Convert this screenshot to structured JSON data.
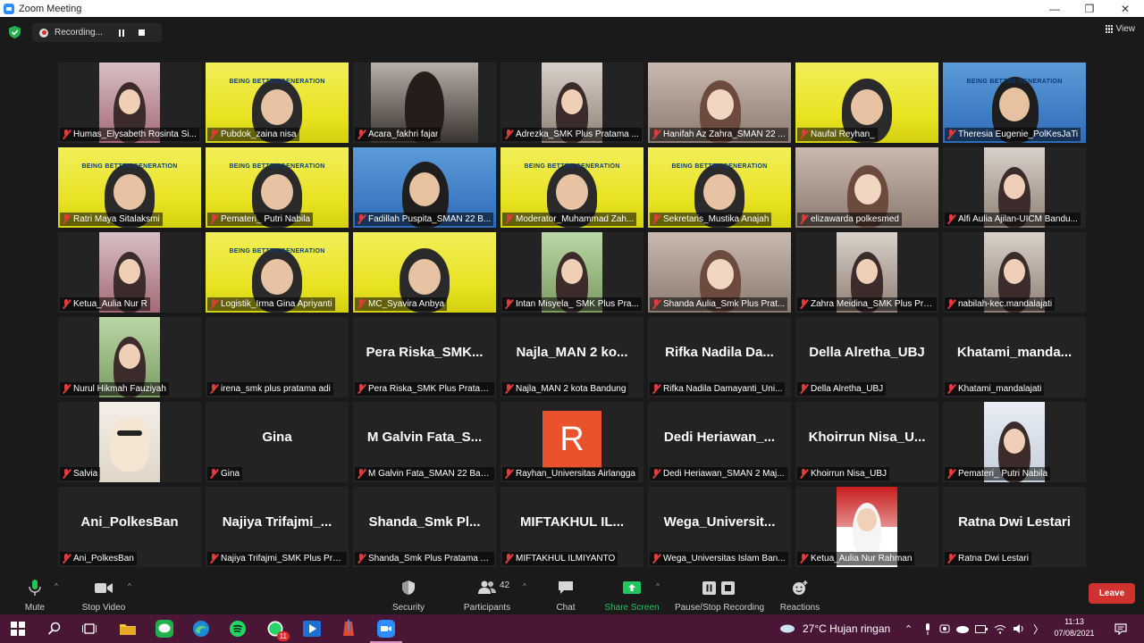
{
  "window": {
    "title": "Zoom Meeting"
  },
  "recording": {
    "label": "Recording..."
  },
  "view_label": "View",
  "participants_tiles": [
    {
      "name": "Humas_Elysabeth Rosinta Si...",
      "big": "",
      "kind": "narrow-pink"
    },
    {
      "name": "Pubdok_zaina nisa",
      "big": "",
      "kind": "yellow",
      "active": true,
      "banner": "BEING BETTER GENERATION"
    },
    {
      "name": "Acara_fakhri fajar",
      "big": "",
      "kind": "dark-narrow"
    },
    {
      "name": "Adrezka_SMK Plus Pratama ...",
      "big": "",
      "kind": "narrow-room"
    },
    {
      "name": "Hanifah Az Zahra_SMAN 22 ...",
      "big": "",
      "kind": "room"
    },
    {
      "name": "Naufal Reyhan_",
      "big": "",
      "kind": "yellow-plain"
    },
    {
      "name": "Theresia Eugenie_PolKesJaTi",
      "big": "",
      "kind": "blue",
      "banner": "BEING BETTER GENERATION"
    },
    {
      "name": "Ratri Maya Sitalaksmi",
      "big": "",
      "kind": "yellow",
      "banner": "BEING BETTER GENERATION"
    },
    {
      "name": "Pemateri_ Putri Nabila",
      "big": "",
      "kind": "yellow",
      "banner": "BEING BETTER GENERATION"
    },
    {
      "name": "Fadillah Puspita_SMAN 22 B...",
      "big": "",
      "kind": "blue"
    },
    {
      "name": "Moderator_Muhammad Zah...",
      "big": "",
      "kind": "yellow",
      "banner": "BEING BETTER GENERATION"
    },
    {
      "name": "Sekretaris_Mustika Anajah",
      "big": "",
      "kind": "yellow",
      "banner": "BEING BETTER GENERATION"
    },
    {
      "name": "elizawarda polkesmed",
      "big": "",
      "kind": "room"
    },
    {
      "name": "Alfi Aulia Ajilan-UICM Bandu...",
      "big": "",
      "kind": "narrow-room"
    },
    {
      "name": "Ketua_Aulia Nur R",
      "big": "",
      "kind": "narrow-pink"
    },
    {
      "name": "Logistik_Irma Gina Apriyanti",
      "big": "",
      "kind": "yellow",
      "banner": "BEING BETTER GENERATION"
    },
    {
      "name": "MC_Syavira Anbya",
      "big": "",
      "kind": "yellow"
    },
    {
      "name": "Intan Misyela_ SMK Plus Pra...",
      "big": "",
      "kind": "narrow-green"
    },
    {
      "name": "Shanda Aulia_Smk Plus Prat...",
      "big": "",
      "kind": "room"
    },
    {
      "name": "Zahra Meidina_SMK Plus Pra...",
      "big": "",
      "kind": "narrow-room"
    },
    {
      "name": "nabilah-kec.mandalajati",
      "big": "",
      "kind": "narrow-room"
    },
    {
      "name": "Nurul Hikmah Fauziyah",
      "big": "",
      "kind": "narrow-green"
    },
    {
      "name": "irena_smk plus pratama adi",
      "big": "",
      "kind": "empty"
    },
    {
      "name": "Pera Riska_SMK Plus Pratam...",
      "big": "Pera  Riska_SMK...",
      "kind": "text"
    },
    {
      "name": "Najla_MAN 2 kota Bandung",
      "big": "Najla_MAN  2  ko...",
      "kind": "text"
    },
    {
      "name": "Rifka Nadila Damayanti_Uni...",
      "big": "Rifka  Nadila  Da...",
      "kind": "text"
    },
    {
      "name": "Della Alretha_UBJ",
      "big": "Della Alretha_UBJ",
      "kind": "text"
    },
    {
      "name": "Khatami_mandalajati",
      "big": "Khatami_manda...",
      "kind": "text"
    },
    {
      "name": "Salvia",
      "big": "",
      "kind": "narrow-cat"
    },
    {
      "name": "Gina",
      "big": "Gina",
      "kind": "text"
    },
    {
      "name": "M Galvin Fata_SMAN 22 Ban...",
      "big": "M  Galvin  Fata_S...",
      "kind": "text"
    },
    {
      "name": "Rayhan_Universitas Airlangga",
      "big": "",
      "kind": "avatar",
      "avatar_letter": "R"
    },
    {
      "name": "Dedi Heriawan_SMAN 2 Maj...",
      "big": "Dedi  Heriawan_...",
      "kind": "text"
    },
    {
      "name": "Khoirrun Nisa_UBJ",
      "big": "Khoirrun  Nisa_U...",
      "kind": "text"
    },
    {
      "name": "Pemateri_ Putri Nabila",
      "big": "",
      "kind": "narrow-photo"
    },
    {
      "name": "Ani_PolkesBan",
      "big": "Ani_PolkesBan",
      "kind": "text"
    },
    {
      "name": "Najiya Trifajmi_SMK Plus Pra...",
      "big": "Najiya  Trifajmi_...",
      "kind": "text"
    },
    {
      "name": "Shanda_Smk Plus Pratama A...",
      "big": "Shanda_Smk  Pl...",
      "kind": "text"
    },
    {
      "name": "MIFTAKHUL ILMIYANTO",
      "big": "MIFTAKHUL  IL...",
      "kind": "text"
    },
    {
      "name": "Wega_Universitas Islam Ban...",
      "big": "Wega_Universit...",
      "kind": "text"
    },
    {
      "name": "Ketua_Aulia Nur Rahman",
      "big": "",
      "kind": "narrow-red"
    },
    {
      "name": "Ratna Dwi Lestari",
      "big": "Ratna Dwi Lestari",
      "kind": "text"
    }
  ],
  "toolbar": {
    "mute": "Mute",
    "stop_video": "Stop Video",
    "security": "Security",
    "participants": "Participants",
    "participants_count": "42",
    "chat": "Chat",
    "share_screen": "Share Screen",
    "pause_stop_recording": "Pause/Stop Recording",
    "reactions": "Reactions",
    "leave": "Leave"
  },
  "taskbar": {
    "weather": "27°C  Hujan ringan",
    "time": "11:13",
    "date": "07/08/2021",
    "whatsapp_badge": "11"
  },
  "colors": {
    "share_green": "#22c55e",
    "leave_red": "#d0322f",
    "active_outline": "#d7dc2a",
    "taskbar": "#4a1636"
  }
}
